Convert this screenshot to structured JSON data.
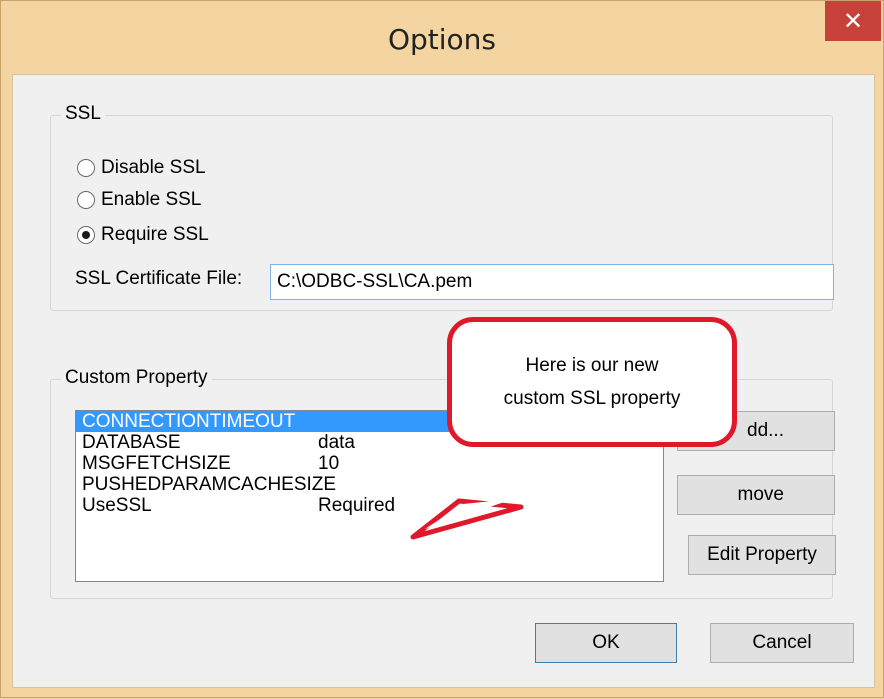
{
  "window": {
    "title": "Options",
    "close_glyph": "✕"
  },
  "ssl": {
    "group_label": "SSL",
    "options": [
      "Disable SSL",
      "Enable SSL",
      "Require SSL"
    ],
    "selected_index": 2,
    "cert_label": "SSL Certificate File:",
    "cert_value": "C:\\ODBC-SSL\\CA.pem"
  },
  "custom_property": {
    "group_label": "Custom Property",
    "rows": [
      {
        "name": "CONNECTIONTIMEOUT",
        "value": ""
      },
      {
        "name": "DATABASE",
        "value": "data"
      },
      {
        "name": "MSGFETCHSIZE",
        "value": "10"
      },
      {
        "name": "PUSHEDPARAMCACHESIZE",
        "value": ""
      },
      {
        "name": "UseSSL",
        "value": "Required"
      }
    ],
    "selected_index": 0,
    "buttons": {
      "add": "dd...",
      "remove": "move",
      "edit": "Edit Property"
    }
  },
  "callout": {
    "line1": "Here is our new",
    "line2": "custom SSL property",
    "border_color": "#e0192a"
  },
  "footer": {
    "ok": "OK",
    "cancel": "Cancel"
  },
  "colors": {
    "frame": "#f4d5a1",
    "close": "#c7413b",
    "selection": "#3399ff"
  }
}
